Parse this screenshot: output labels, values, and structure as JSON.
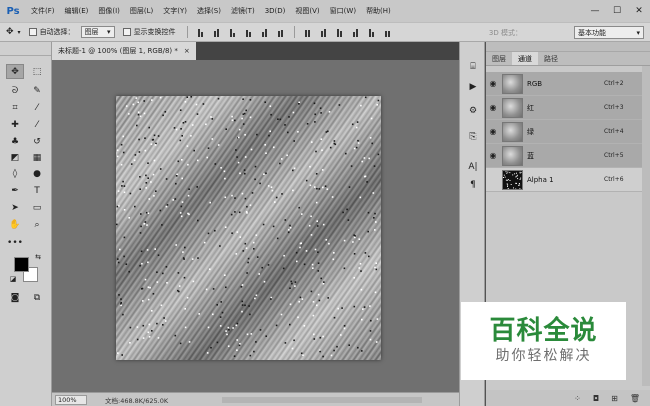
{
  "app": {
    "logo": "Ps"
  },
  "menu": [
    "文件(F)",
    "编辑(E)",
    "图像(I)",
    "图层(L)",
    "文字(Y)",
    "选择(S)",
    "滤镜(T)",
    "3D(D)",
    "视图(V)",
    "窗口(W)",
    "帮助(H)"
  ],
  "window_controls": {
    "minimize": "—",
    "maximize": "☐",
    "close": "✕"
  },
  "options": {
    "auto_select_label": "自动选择：",
    "auto_select_value": "图层",
    "show_transform_label": "显示变换控件",
    "mode_3d_label": "3D 模式：",
    "workspace": "基本功能"
  },
  "document": {
    "tab_title": "未标题-1 @ 100% (图层 1, RGB/8) *",
    "tab_close": "×",
    "zoom": "100%",
    "doc_info": "文档:468.8K/625.0K"
  },
  "channels_panel": {
    "tabs": [
      "图层",
      "通道",
      "路径"
    ],
    "active_tab": "通道",
    "channels": [
      {
        "name": "RGB",
        "shortcut": "Ctrl+2",
        "visible": true
      },
      {
        "name": "红",
        "shortcut": "Ctrl+3",
        "visible": true
      },
      {
        "name": "绿",
        "shortcut": "Ctrl+4",
        "visible": true
      },
      {
        "name": "蓝",
        "shortcut": "Ctrl+5",
        "visible": true
      },
      {
        "name": "Alpha 1",
        "shortcut": "Ctrl+6",
        "visible": false
      }
    ]
  },
  "watermark": {
    "title": "百科全说",
    "subtitle": "助你轻松解决"
  },
  "colors": {
    "accent": "#2a8a3a",
    "ps_blue": "#1a5fb4",
    "foreground": "#000000",
    "background": "#ffffff"
  },
  "icons": {
    "tools": [
      "move-tool-icon",
      "marquee-tool-icon",
      "lasso-tool-icon",
      "quick-select-tool-icon",
      "crop-tool-icon",
      "eyedropper-tool-icon",
      "healing-brush-icon",
      "brush-tool-icon",
      "clone-stamp-icon",
      "history-brush-icon",
      "eraser-tool-icon",
      "gradient-tool-icon",
      "blur-tool-icon",
      "dodge-tool-icon",
      "pen-tool-icon",
      "type-tool-icon",
      "path-select-icon",
      "rectangle-tool-icon",
      "hand-tool-icon",
      "zoom-tool-icon"
    ]
  }
}
